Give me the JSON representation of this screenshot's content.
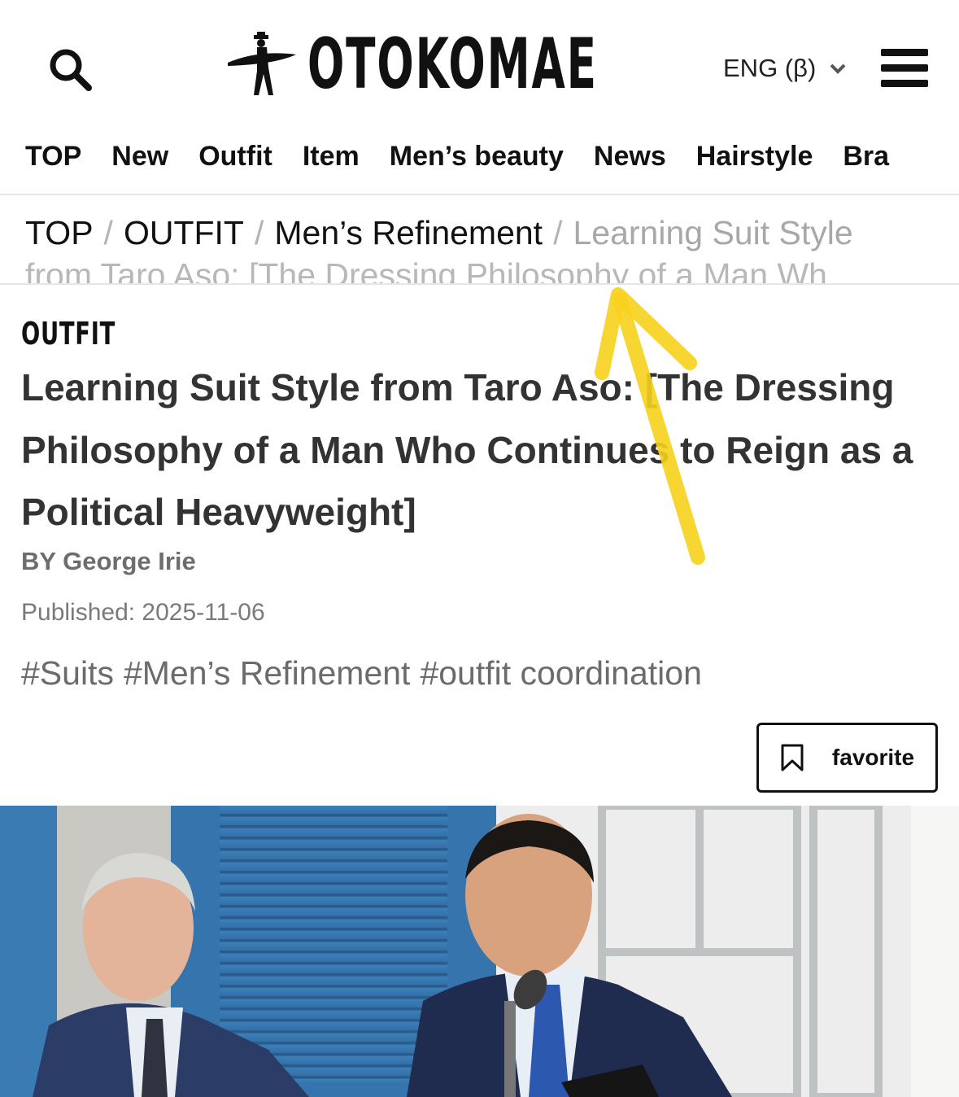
{
  "header": {
    "logo_text": "OTOKOMAE",
    "language_label": "ENG (β)"
  },
  "category_nav": [
    "TOP",
    "New",
    "Outfit",
    "Item",
    "Men’s beauty",
    "News",
    "Hairstyle",
    "Bra"
  ],
  "breadcrumb": {
    "items": [
      "TOP",
      "OUTFIT",
      "Men’s Refinement"
    ],
    "current": "Learning Suit Style",
    "current_overflow": "from Taro Aso: [The Dressing Philosophy of a Man Wh"
  },
  "article": {
    "category": "OUTFIT",
    "title": "Learning Suit Style from Taro Aso: [The Dressing Philosophy of a Man Who Continues to Reign as a Political Heavyweight]",
    "author": "BY George Irie",
    "published": "Published: 2025-11-06",
    "tags": [
      "#Suits",
      "#Men’s Refinement",
      "#outfit coordination"
    ],
    "favorite_label": "favorite"
  },
  "colors": {
    "annotation_arrow": "#f7d21c",
    "text_dark": "#333333",
    "text_muted": "#6b6b6b"
  }
}
